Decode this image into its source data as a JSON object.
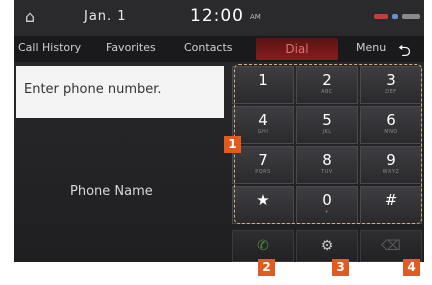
{
  "status_bar": {
    "date": "Jan. 1",
    "time": "12:00",
    "time_suffix": "AM"
  },
  "tabs": [
    {
      "label": "Call History"
    },
    {
      "label": "Favorites"
    },
    {
      "label": "Contacts"
    },
    {
      "label": "Dial",
      "active": true
    },
    {
      "label": "Menu"
    }
  ],
  "dial": {
    "placeholder": "Enter phone number.",
    "phone_name": "Phone Name"
  },
  "keypad": {
    "keys": [
      {
        "digit": "1",
        "sub": ""
      },
      {
        "digit": "2",
        "sub": "ABC"
      },
      {
        "digit": "3",
        "sub": "DEF"
      },
      {
        "digit": "4",
        "sub": "GHI"
      },
      {
        "digit": "5",
        "sub": "JKL"
      },
      {
        "digit": "6",
        "sub": "MNO"
      },
      {
        "digit": "7",
        "sub": "PQRS"
      },
      {
        "digit": "8",
        "sub": "TUV"
      },
      {
        "digit": "9",
        "sub": "WXYZ"
      },
      {
        "digit": "★",
        "sub": ""
      },
      {
        "digit": "0",
        "sub": "+"
      },
      {
        "digit": "#",
        "sub": ""
      }
    ]
  },
  "actions": [
    {
      "icon": "call-icon"
    },
    {
      "icon": "settings-icon"
    },
    {
      "icon": "delete-icon"
    }
  ],
  "callouts": [
    "1",
    "2",
    "3",
    "4"
  ],
  "colors": {
    "accent_red": "#8a1c1c",
    "callout_orange": "#e35a1e",
    "keypad_outline": "#d8b07a"
  }
}
